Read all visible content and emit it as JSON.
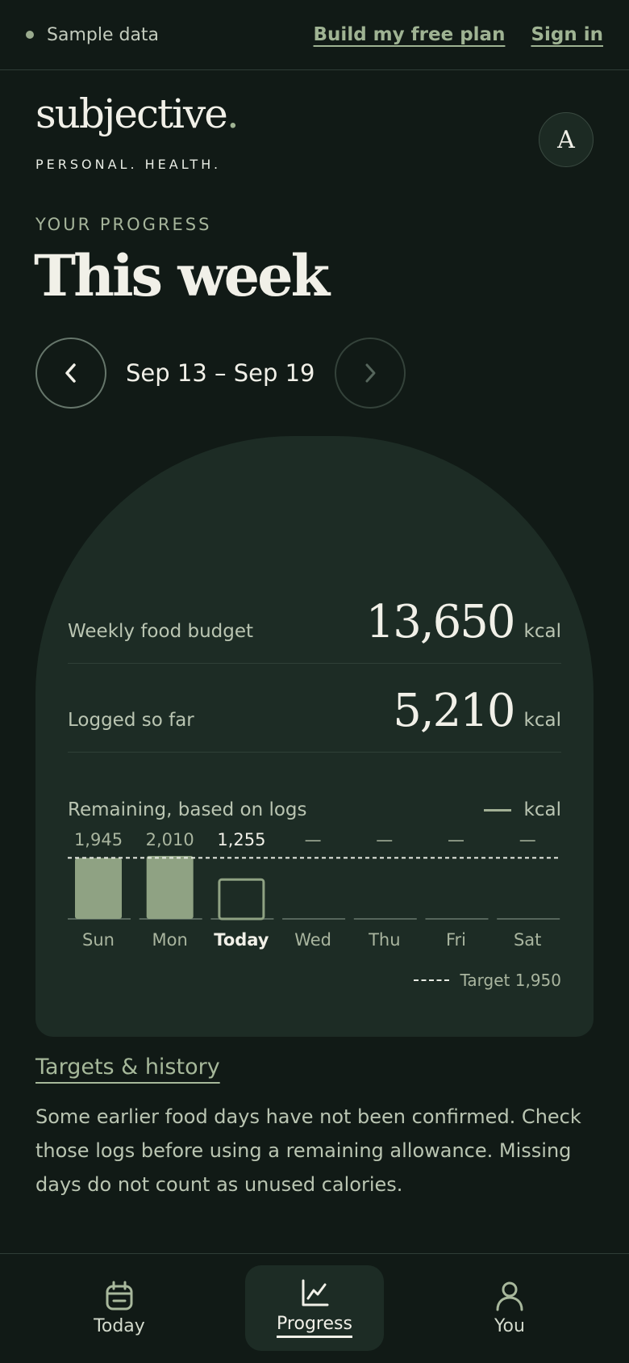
{
  "topbar": {
    "sample_label": "Sample data",
    "build_plan_link": "Build my free plan",
    "sign_in_link": "Sign in"
  },
  "brand": {
    "logo_text": "subjective",
    "logo_dot": ".",
    "tagline": "PERSONAL. HEALTH.",
    "avatar_initial": "A"
  },
  "header": {
    "eyebrow": "YOUR PROGRESS",
    "title": "This week",
    "date_range": "Sep 13 – Sep 19"
  },
  "summary": {
    "budget_label": "Weekly food budget",
    "budget_value": "13,650",
    "logged_label": "Logged so far",
    "logged_value": "5,210",
    "remaining_label": "Remaining, based on logs",
    "unit": "kcal"
  },
  "chart_data": {
    "type": "bar",
    "categories": [
      "Sun",
      "Mon",
      "Today",
      "Wed",
      "Thu",
      "Fri",
      "Sat"
    ],
    "values": [
      1945,
      2010,
      1255,
      null,
      null,
      null,
      null
    ],
    "value_labels": [
      "1,945",
      "2,010",
      "1,255",
      "—",
      "—",
      "—",
      "—"
    ],
    "highlight_index": 2,
    "target": 1950,
    "target_label": "Target 1,950",
    "ylim": [
      0,
      2010
    ]
  },
  "footer": {
    "history_link": "Targets & history",
    "note": "Some earlier food days have not been confirmed. Check those logs before using a remaining allowance. Missing days do not count as unused calories."
  },
  "bottom_nav": {
    "items": [
      {
        "label": "Today"
      },
      {
        "label": "Progress"
      },
      {
        "label": "You"
      }
    ]
  },
  "colors": {
    "background": "#111a16",
    "card": "#1d2c25",
    "accent": "#9fb393",
    "bar_fill": "#8fa283"
  }
}
